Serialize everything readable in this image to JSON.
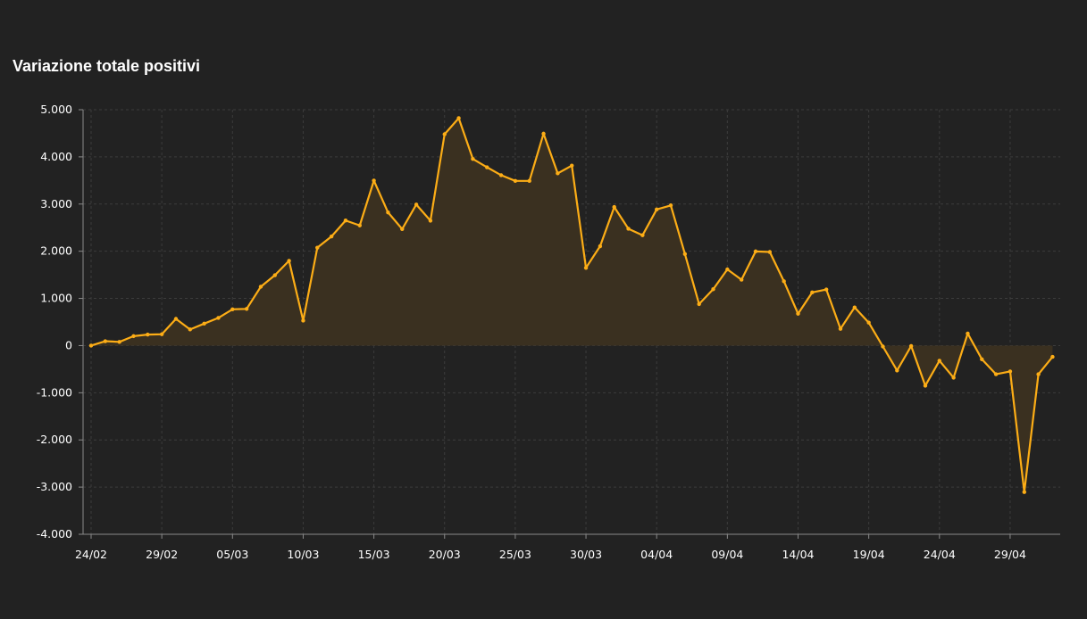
{
  "colors": {
    "background": "#222222",
    "line": "#fcad16",
    "area": "#3a3020",
    "grid": "#3c3c3c",
    "axis": "#8a8a8a",
    "text": "#ffffff"
  },
  "chart_data": {
    "type": "area",
    "title": "Variazione totale positivi",
    "xlabel": "",
    "ylabel": "",
    "ylim": [
      -4000,
      5000
    ],
    "y_ticks": [
      5000,
      4000,
      3000,
      2000,
      1000,
      0,
      -1000,
      -2000,
      -3000,
      -4000
    ],
    "y_tick_labels": [
      "5.000",
      "4.000",
      "3.000",
      "2.000",
      "1.000",
      "0",
      "-1.000",
      "-2.000",
      "-3.000",
      "-4.000"
    ],
    "x_tick_labels": [
      "24/02",
      "29/02",
      "05/03",
      "10/03",
      "15/03",
      "20/03",
      "25/03",
      "30/03",
      "04/04",
      "09/04",
      "14/04",
      "19/04",
      "24/04",
      "29/04"
    ],
    "grid": true,
    "legend": "none",
    "series": [
      {
        "x": [
          "24/02",
          "25/02",
          "26/02",
          "27/02",
          "28/02",
          "29/02",
          "01/03",
          "02/03",
          "03/03",
          "04/03",
          "05/03",
          "06/03",
          "07/03",
          "08/03",
          "09/03",
          "10/03",
          "11/03",
          "12/03",
          "13/03",
          "14/03",
          "15/03",
          "16/03",
          "17/03",
          "18/03",
          "19/03",
          "20/03",
          "21/03",
          "22/03",
          "23/03",
          "24/03",
          "25/03",
          "26/03",
          "27/03",
          "28/03",
          "29/03",
          "30/03",
          "31/03",
          "01/04",
          "02/04",
          "03/04",
          "04/04",
          "05/04",
          "06/04",
          "07/04",
          "08/04",
          "09/04",
          "10/04",
          "11/04",
          "12/04",
          "13/04",
          "14/04",
          "15/04",
          "16/04",
          "17/04",
          "18/04",
          "19/04",
          "20/04",
          "21/04",
          "22/04",
          "23/04",
          "24/04",
          "25/04",
          "26/04",
          "27/04",
          "28/04",
          "29/04",
          "30/04",
          "01/05",
          "02/05"
        ],
        "values": [
          0,
          93,
          78,
          200,
          233,
          240,
          566,
          342,
          466,
          587,
          769,
          778,
          1247,
          1492,
          1797,
          529,
          2076,
          2313,
          2651,
          2547,
          3497,
          2823,
          2470,
          2989,
          2648,
          4480,
          4821,
          3957,
          3780,
          3612,
          3491,
          3491,
          4492,
          3651,
          3815,
          1648,
          2107,
          2937,
          2477,
          2339,
          2886,
          2972,
          1941,
          880,
          1195,
          1615,
          1396,
          1996,
          1984,
          1363,
          675,
          1127,
          1189,
          355,
          809,
          486,
          -20,
          -528,
          -10,
          -851,
          -321,
          -680,
          256,
          -290,
          -608,
          -548,
          -3106,
          -608,
          -239
        ]
      }
    ]
  }
}
